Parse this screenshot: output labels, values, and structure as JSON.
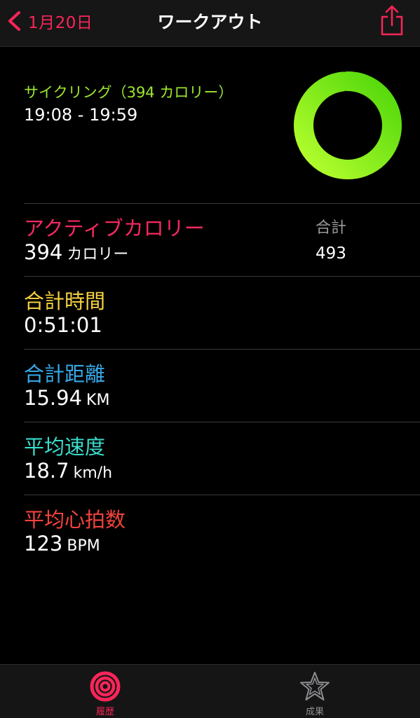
{
  "nav": {
    "back_label": "1月20日",
    "title": "ワークアウト"
  },
  "header": {
    "workout_name": "サイクリング（394 カロリー）",
    "time_range": "19:08 - 19:59",
    "ring_progress": 0.98
  },
  "metrics": [
    {
      "label": "アクティブカロリー",
      "value": "394",
      "unit": "カロリー",
      "color": "#f5295f"
    },
    {
      "label": "合計時間",
      "value": "0:51:01",
      "unit": "",
      "color": "#f4d03f"
    },
    {
      "label": "合計距離",
      "value": "15.94",
      "unit": "KM",
      "color": "#36a9e8"
    },
    {
      "label": "平均速度",
      "value": "18.7",
      "unit": "km/h",
      "color": "#39dccb"
    },
    {
      "label": "平均心拍数",
      "value": "123",
      "unit": "BPM",
      "color": "#f2433c"
    }
  ],
  "total": {
    "label": "合計",
    "value": "493"
  },
  "tabs": [
    {
      "label": "履歴",
      "icon": "activity-rings-icon",
      "active": true
    },
    {
      "label": "成果",
      "icon": "star-badge-icon",
      "active": false
    }
  ],
  "colors": {
    "accent": "#fa2559",
    "ring_light": "#b8ff2e",
    "ring_dark": "#4fd70a"
  }
}
